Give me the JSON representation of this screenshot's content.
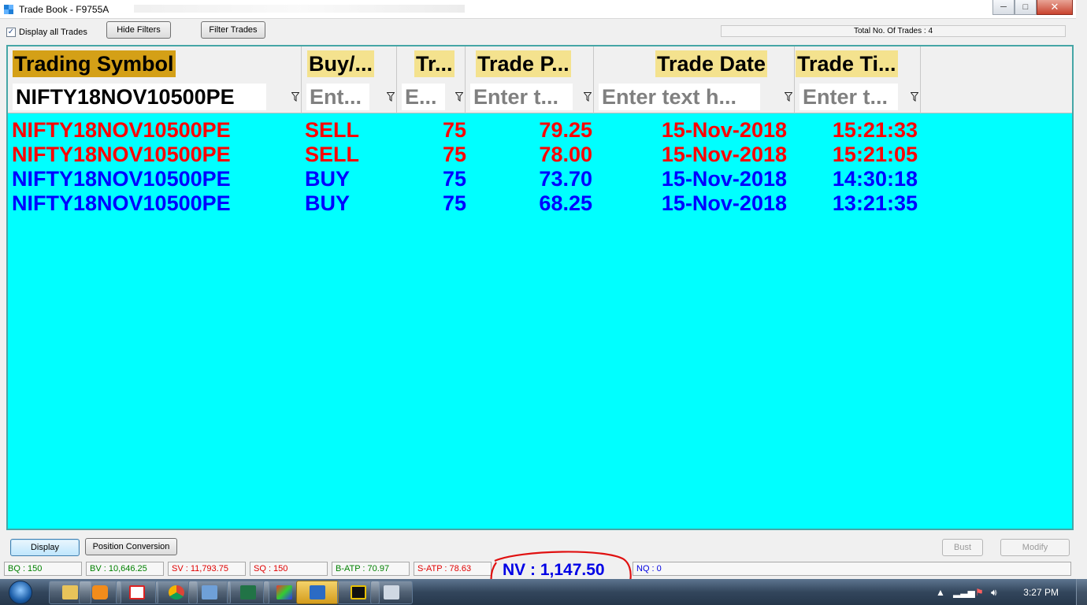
{
  "window": {
    "title": "Trade Book - F9755A",
    "minimize": "─",
    "maximize": "□",
    "close": "✕"
  },
  "toolbar": {
    "display_all_label": "Display all Trades",
    "display_all_checked": true,
    "hide_filters_label": "Hide Filters",
    "filter_trades_label": "Filter Trades",
    "total_trades_label": "Total No. Of Trades : 4"
  },
  "grid": {
    "columns": [
      {
        "label": "Trading Symbol",
        "filter": "NIFTY18NOV10500PE"
      },
      {
        "label": "Buy/...",
        "filter": "Ent..."
      },
      {
        "label": "Tr...",
        "filter": "E..."
      },
      {
        "label": "Trade P...",
        "filter": "Enter t..."
      },
      {
        "label": "Trade Date",
        "filter": "Enter text h..."
      },
      {
        "label": "Trade Ti...",
        "filter": "Enter t..."
      }
    ],
    "rows": [
      {
        "side": "sell",
        "cells": [
          "NIFTY18NOV10500PE",
          "SELL",
          "75",
          "79.25",
          "15-Nov-2018",
          "15:21:33"
        ]
      },
      {
        "side": "sell",
        "cells": [
          "NIFTY18NOV10500PE",
          "SELL",
          "75",
          "78.00",
          "15-Nov-2018",
          "15:21:05"
        ]
      },
      {
        "side": "buy",
        "cells": [
          "NIFTY18NOV10500PE",
          "BUY",
          "75",
          "73.70",
          "15-Nov-2018",
          "14:30:18"
        ]
      },
      {
        "side": "buy",
        "cells": [
          "NIFTY18NOV10500PE",
          "BUY",
          "75",
          "68.25",
          "15-Nov-2018",
          "13:21:35"
        ]
      }
    ],
    "colors": {
      "background": "#00ffff",
      "sell": "#ff0000",
      "buy": "#0000ff",
      "symbol_header": "#d4a017",
      "header": "#f4e28e"
    }
  },
  "actions": {
    "display_label": "Display",
    "position_conversion_label": "Position Conversion",
    "bust_label": "Bust",
    "modify_label": "Modify"
  },
  "stats": {
    "bq": "BQ : 150",
    "bv": "BV : 10,646.25",
    "sv": "SV : 11,793.75",
    "sq": "SQ : 150",
    "batp": "B-ATP : 70.97",
    "satp": "S-ATP : 78.63",
    "nv": "NV : 1,147.50",
    "nq": "NQ : 0"
  },
  "taskbar": {
    "icons": [
      "windows-start-icon",
      "file-explorer-icon",
      "media-player-icon",
      "network-tool-icon",
      "chrome-icon",
      "window-app-icon",
      "excel-icon",
      "trading-app-icon",
      "folder-app-icon",
      "terminal-app-icon",
      "calculator-icon"
    ],
    "clock": "3:27 PM"
  }
}
